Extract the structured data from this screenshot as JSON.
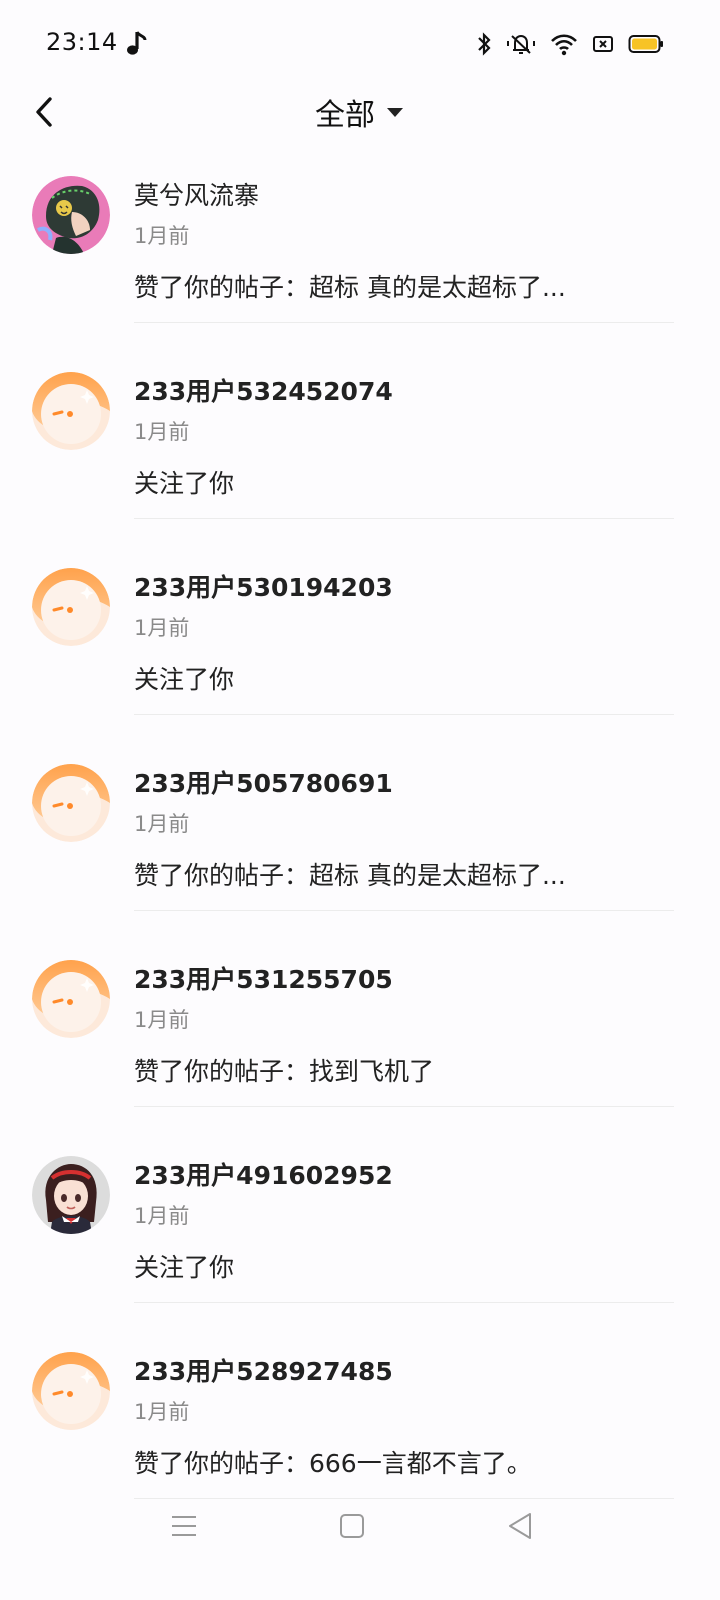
{
  "status_bar": {
    "time": "23:14",
    "icons": [
      "music-note-icon",
      "bluetooth-icon",
      "silent-bell-icon",
      "wifi-icon",
      "sim-off-icon",
      "battery-icon"
    ],
    "battery_color": "#f7c325"
  },
  "header": {
    "back_icon": "chevron-left-icon",
    "title": "全部",
    "dropdown_icon": "caret-down-icon"
  },
  "notifications": [
    {
      "name": "莫兮风流寨",
      "time": "1月前",
      "action": "赞了你的帖子：超标 真的是太超标了...",
      "avatar": "custom-avatar-helmet",
      "name_bold": false
    },
    {
      "name": "233用户532452074",
      "time": "1月前",
      "action": "关注了你",
      "avatar": "default-orange-avatar",
      "name_bold": true
    },
    {
      "name": "233用户530194203",
      "time": "1月前",
      "action": "关注了你",
      "avatar": "default-orange-avatar",
      "name_bold": true
    },
    {
      "name": "233用户505780691",
      "time": "1月前",
      "action": "赞了你的帖子：超标 真的是太超标了...",
      "avatar": "default-orange-avatar",
      "name_bold": true
    },
    {
      "name": "233用户531255705",
      "time": "1月前",
      "action": "赞了你的帖子：找到飞机了",
      "avatar": "default-orange-avatar",
      "name_bold": true
    },
    {
      "name": "233用户491602952",
      "time": "1月前",
      "action": "关注了你",
      "avatar": "custom-avatar-girl",
      "name_bold": true
    },
    {
      "name": "233用户528927485",
      "time": "1月前",
      "action": "赞了你的帖子：666一言都不言了。",
      "avatar": "default-orange-avatar",
      "name_bold": true
    }
  ],
  "bottom_nav": {
    "icons": [
      "menu-icon",
      "home-square-icon",
      "back-triangle-icon"
    ]
  },
  "colors": {
    "accent_orange": "#ff9a3c",
    "background": "#fdfcfe",
    "secondary_text": "#8a8a8a"
  }
}
